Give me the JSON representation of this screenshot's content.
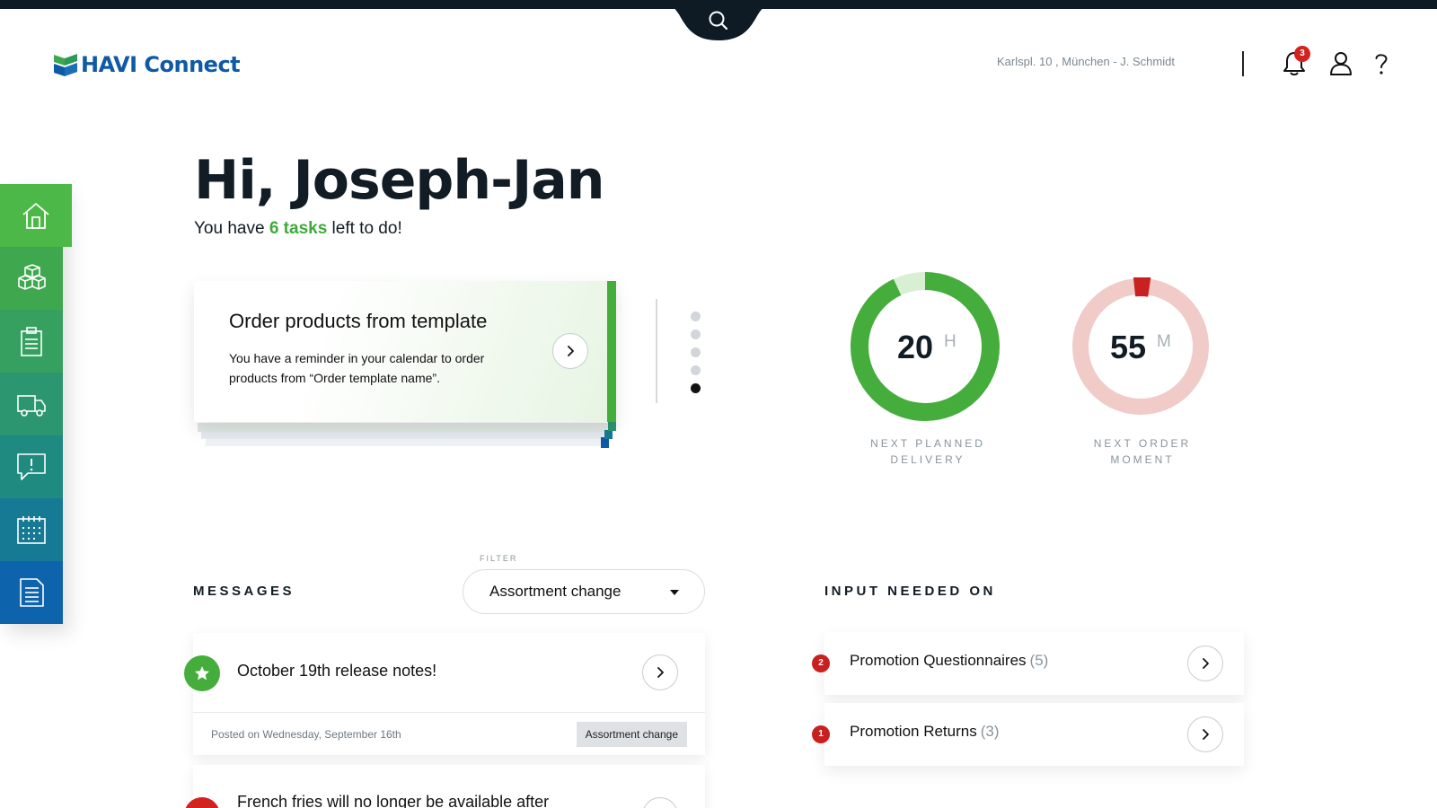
{
  "header": {
    "brand": "HAVI Connect",
    "location": "Karlspl. 10 , München   -   J. Schmidt",
    "notification_count": "3",
    "icons": {
      "search": "search-icon",
      "notifications": "bell-icon",
      "user": "user-icon",
      "help": "help-icon"
    }
  },
  "sidebar": {
    "items": [
      {
        "name": "home",
        "icon": "home-icon",
        "active": true,
        "color": "#4cb847"
      },
      {
        "name": "products",
        "icon": "boxes-icon",
        "color": "#3fa84f"
      },
      {
        "name": "orders",
        "icon": "clipboard-icon",
        "color": "#36a060"
      },
      {
        "name": "deliveries",
        "icon": "truck-icon",
        "color": "#2c9670"
      },
      {
        "name": "messages",
        "icon": "alert-message-icon",
        "color": "#1f8a80"
      },
      {
        "name": "calendar",
        "icon": "calendar-icon",
        "color": "#177a94"
      },
      {
        "name": "documents",
        "icon": "document-icon",
        "color": "#0e63ad"
      }
    ]
  },
  "greeting": {
    "title": "Hi, Joseph-Jan",
    "prefix": "You have ",
    "tasks": "6 tasks",
    "suffix": " left to do!"
  },
  "task_card": {
    "title": "Order products from template",
    "text": "You have a reminder in your calendar to order products from “Order template name”.",
    "pager_count": 5,
    "pager_active": 4
  },
  "gauges": [
    {
      "value": "20",
      "unit": "H",
      "label_line1": "NEXT PLANNED",
      "label_line2": "DELIVERY",
      "fraction": 0.93,
      "color": "#45ad3c",
      "track": "#d9efd4"
    },
    {
      "value": "55",
      "unit": "M",
      "label_line1": "NEXT ORDER",
      "label_line2": "MOMENT",
      "fraction": 0.04,
      "color": "#c9211f",
      "track": "#f1cbc7"
    }
  ],
  "messages": {
    "title": "MESSAGES",
    "filter_label": "FILTER",
    "filter_value": "Assortment change",
    "items": [
      {
        "title": "October 19th release notes!",
        "meta": "Posted on Wednesday, September 16th",
        "tag": "Assortment change",
        "icon": "star-icon",
        "color": "#45ad3c"
      },
      {
        "title": "French fries will no longer be available after",
        "icon": "alert-icon",
        "color": "#d2231f"
      }
    ]
  },
  "input_needed": {
    "title": "INPUT NEEDED ON",
    "items": [
      {
        "label": "Promotion Questionnaires",
        "count": "(5)",
        "badge": "2"
      },
      {
        "label": "Promotion Returns",
        "count": "(3)",
        "badge": "1"
      }
    ]
  }
}
